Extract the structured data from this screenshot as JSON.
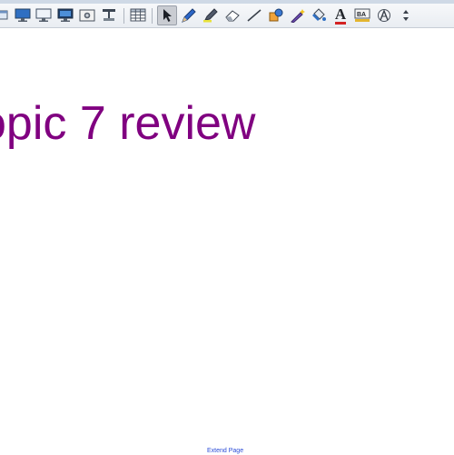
{
  "window": {
    "kind": "whiteboard toolbar"
  },
  "toolbar": {
    "buttons": [
      {
        "icon": "window-icon"
      },
      {
        "icon": "monitor-icon"
      },
      {
        "icon": "monitor-outline-icon"
      },
      {
        "icon": "monitor-screen-icon"
      },
      {
        "icon": "camera-window-icon"
      },
      {
        "icon": "document-camera-icon"
      },
      {
        "icon": "table-icon"
      },
      {
        "icon": "select-arrow-icon",
        "active": true
      },
      {
        "icon": "pen-icon"
      },
      {
        "icon": "highlighter-icon"
      },
      {
        "icon": "eraser-icon"
      },
      {
        "icon": "line-icon"
      },
      {
        "icon": "shapes-icon"
      },
      {
        "icon": "magic-pen-icon"
      },
      {
        "icon": "fill-icon"
      },
      {
        "icon": "text-icon"
      },
      {
        "icon": "recognition-icon"
      },
      {
        "icon": "measure-tools-icon"
      },
      {
        "icon": "more-arrows-icon"
      }
    ],
    "text_label": "A",
    "colors": {
      "accent_purple": "#800080",
      "link_blue": "#2a4bd7"
    }
  },
  "canvas": {
    "title": "opic 7 review",
    "extend_page_label": "Extend Page"
  }
}
